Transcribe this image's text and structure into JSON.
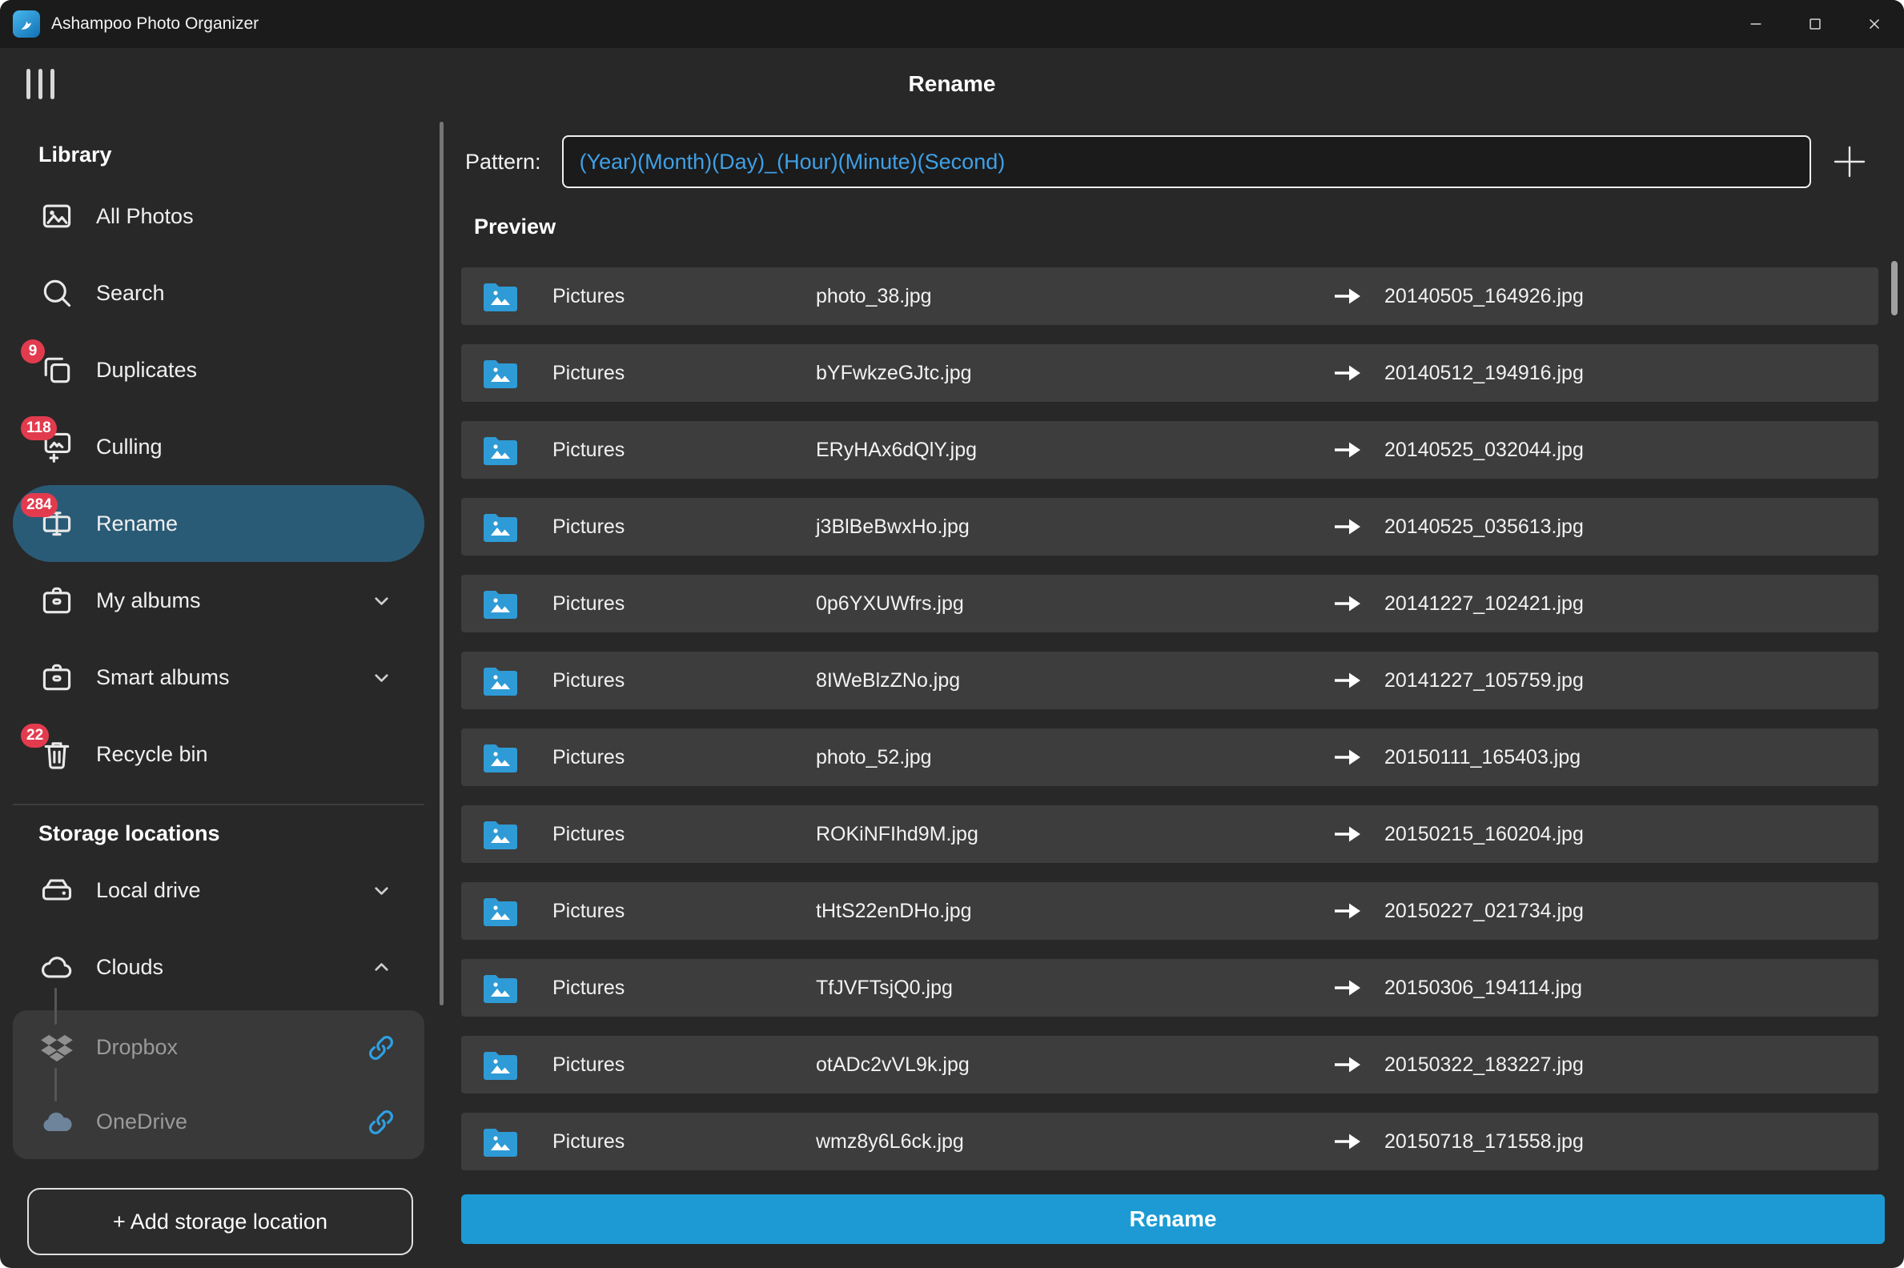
{
  "window": {
    "title": "Ashampoo Photo Organizer"
  },
  "header": {
    "title": "Rename"
  },
  "sidebar": {
    "library_heading": "Library",
    "items": [
      {
        "label": "All Photos",
        "icon": "photos-icon"
      },
      {
        "label": "Search",
        "icon": "search-icon"
      },
      {
        "label": "Duplicates",
        "icon": "duplicates-icon",
        "badge": "9"
      },
      {
        "label": "Culling",
        "icon": "culling-icon",
        "badge": "118"
      },
      {
        "label": "Rename",
        "icon": "rename-icon",
        "badge": "284",
        "selected": true
      },
      {
        "label": "My albums",
        "icon": "albums-icon",
        "chevron": "down"
      },
      {
        "label": "Smart albums",
        "icon": "albums-icon",
        "chevron": "down"
      },
      {
        "label": "Recycle bin",
        "icon": "trash-icon",
        "badge": "22"
      }
    ],
    "storage_heading": "Storage locations",
    "storage": [
      {
        "label": "Local drive",
        "icon": "drive-icon",
        "chevron": "down"
      },
      {
        "label": "Clouds",
        "icon": "cloud-icon",
        "chevron": "up"
      },
      {
        "label": "Dropbox",
        "icon": "dropbox-icon",
        "linked": true
      },
      {
        "label": "OneDrive",
        "icon": "onedrive-icon",
        "linked": true
      }
    ],
    "add_storage_label": "+ Add storage location"
  },
  "pattern": {
    "label": "Pattern:",
    "value": "(Year)(Month)(Day)_(Hour)(Minute)(Second)"
  },
  "preview": {
    "heading": "Preview",
    "rows": [
      {
        "folder": "Pictures",
        "original": "photo_38.jpg",
        "renamed": "20140505_164926.jpg"
      },
      {
        "folder": "Pictures",
        "original": "bYFwkzeGJtc.jpg",
        "renamed": "20140512_194916.jpg"
      },
      {
        "folder": "Pictures",
        "original": "ERyHAx6dQlY.jpg",
        "renamed": "20140525_032044.jpg"
      },
      {
        "folder": "Pictures",
        "original": "j3BlBeBwxHo.jpg",
        "renamed": "20140525_035613.jpg"
      },
      {
        "folder": "Pictures",
        "original": "0p6YXUWfrs.jpg",
        "renamed": "20141227_102421.jpg"
      },
      {
        "folder": "Pictures",
        "original": "8IWeBlzZNo.jpg",
        "renamed": "20141227_105759.jpg"
      },
      {
        "folder": "Pictures",
        "original": "photo_52.jpg",
        "renamed": "20150111_165403.jpg"
      },
      {
        "folder": "Pictures",
        "original": "ROKiNFIhd9M.jpg",
        "renamed": "20150215_160204.jpg"
      },
      {
        "folder": "Pictures",
        "original": "tHtS22enDHo.jpg",
        "renamed": "20150227_021734.jpg"
      },
      {
        "folder": "Pictures",
        "original": "TfJVFTsjQ0.jpg",
        "renamed": "20150306_194114.jpg"
      },
      {
        "folder": "Pictures",
        "original": "otADc2vVL9k.jpg",
        "renamed": "20150322_183227.jpg"
      },
      {
        "folder": "Pictures",
        "original": "wmz8y6L6ck.jpg",
        "renamed": "20150718_171558.jpg"
      }
    ]
  },
  "footer": {
    "rename_label": "Rename"
  },
  "colors": {
    "accent_blue": "#1d9ad3",
    "pattern_text_blue": "#3fa0e6",
    "badge_red": "#e23b4e",
    "selected_item": "#2a5b76",
    "link_blue": "#2ea1e4",
    "row_bg": "#3d3d3d",
    "app_bg": "#282828",
    "titlebar_bg": "#1b1b1b"
  }
}
